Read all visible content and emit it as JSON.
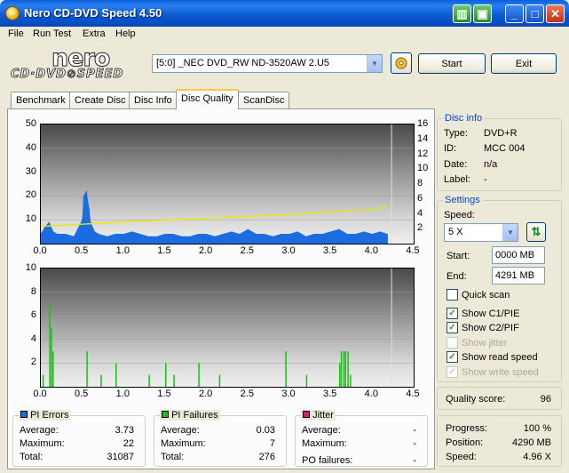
{
  "window": {
    "title": "Nero CD-DVD Speed 4.50"
  },
  "menu": [
    "File",
    "Run Test",
    "Extra",
    "Help"
  ],
  "logo": {
    "brand": "nero",
    "product": "CD·DVD⊘SPEED"
  },
  "drive": {
    "selected": "[5:0]  _NEC DVD_RW ND-3520AW 2.U5"
  },
  "buttons": {
    "start": "Start",
    "exit": "Exit"
  },
  "tabs": [
    "Benchmark",
    "Create Disc",
    "Disc Info",
    "Disc Quality",
    "ScanDisc"
  ],
  "active_tab": "Disc Quality",
  "disc_info": {
    "title": "Disc info",
    "type_label": "Type:",
    "type": "DVD+R",
    "id_label": "ID:",
    "id": "MCC 004",
    "date_label": "Date:",
    "date": "n/a",
    "label_label": "Label:",
    "label": "-"
  },
  "settings": {
    "title": "Settings",
    "speed_label": "Speed:",
    "speed": "5 X",
    "start_label": "Start:",
    "start": "0000 MB",
    "end_label": "End:",
    "end": "4291 MB",
    "quick_scan": "Quick scan",
    "show_c1pie": "Show C1/PIE",
    "show_c2pif": "Show C2/PIF",
    "show_jitter": "Show jitter",
    "show_read_speed": "Show read speed",
    "show_write_speed": "Show write speed"
  },
  "quality": {
    "label": "Quality score:",
    "value": "96"
  },
  "progress": {
    "progress_label": "Progress:",
    "progress": "100 %",
    "position_label": "Position:",
    "position": "4290 MB",
    "speed_label": "Speed:",
    "speed": "4.96 X"
  },
  "pi_errors": {
    "title": "PI Errors",
    "avg_label": "Average:",
    "avg": "3.73",
    "max_label": "Maximum:",
    "max": "22",
    "total_label": "Total:",
    "total": "31087",
    "color": "#1a6ce0"
  },
  "pi_failures": {
    "title": "PI Failures",
    "avg_label": "Average:",
    "avg": "0.03",
    "max_label": "Maximum:",
    "max": "7",
    "total_label": "Total:",
    "total": "276",
    "color": "#18c018"
  },
  "jitter": {
    "title": "Jitter",
    "avg_label": "Average:",
    "avg": "-",
    "max_label": "Maximum:",
    "max": "-",
    "po_label": "PO failures:",
    "po": "-",
    "color": "#e01870"
  },
  "chart_data": [
    {
      "type": "area",
      "title": "PI errors / read speed",
      "x_ticks": [
        "0.0",
        "0.5",
        "1.0",
        "1.5",
        "2.0",
        "2.5",
        "3.0",
        "3.5",
        "4.0",
        "4.5"
      ],
      "y_ticks_left": [
        "50",
        "40",
        "30",
        "20",
        "10"
      ],
      "y_ticks_right": [
        "16",
        "14",
        "12",
        "10",
        "8",
        "6",
        "4",
        "2"
      ],
      "xlim": [
        0,
        4.5
      ],
      "ylim": [
        0,
        50
      ],
      "y2lim": [
        0,
        16
      ],
      "series": [
        {
          "name": "PI Errors",
          "color": "#1a6ce0",
          "x": [
            0.0,
            0.05,
            0.1,
            0.15,
            0.2,
            0.3,
            0.4,
            0.5,
            0.52,
            0.55,
            0.58,
            0.6,
            0.65,
            0.7,
            0.8,
            0.9,
            1.0,
            1.1,
            1.2,
            1.3,
            1.4,
            1.5,
            1.6,
            1.7,
            1.8,
            1.9,
            2.0,
            2.1,
            2.2,
            2.3,
            2.4,
            2.5,
            2.6,
            2.7,
            2.8,
            2.9,
            3.0,
            3.1,
            3.2,
            3.3,
            3.4,
            3.5,
            3.6,
            3.7,
            3.8,
            3.9,
            4.0,
            4.1,
            4.18
          ],
          "y": [
            4,
            7,
            9,
            5,
            4,
            4,
            3,
            10,
            20,
            22,
            15,
            9,
            5,
            4,
            3,
            4,
            4,
            5,
            4,
            3,
            3,
            4,
            4,
            3,
            3,
            4,
            4,
            3,
            4,
            5,
            4,
            6,
            4,
            4,
            3,
            4,
            4,
            5,
            3,
            4,
            4,
            5,
            6,
            4,
            4,
            5,
            4,
            5,
            4
          ]
        },
        {
          "name": "Read Speed",
          "color": "#e8e800",
          "x": [
            0.0,
            1.0,
            2.0,
            3.0,
            4.0,
            4.18
          ],
          "y": [
            2.3,
            2.9,
            3.4,
            3.9,
            4.6,
            4.96
          ]
        }
      ]
    },
    {
      "type": "bar",
      "title": "PI failures",
      "x_ticks": [
        "0.0",
        "0.5",
        "1.0",
        "1.5",
        "2.0",
        "2.5",
        "3.0",
        "3.5",
        "4.0",
        "4.5"
      ],
      "y_ticks_left": [
        "10",
        "8",
        "6",
        "4",
        "2"
      ],
      "xlim": [
        0,
        4.5
      ],
      "ylim": [
        0,
        10
      ],
      "series": [
        {
          "name": "PI Failures",
          "color": "#18c018",
          "x": [
            0.02,
            0.1,
            0.12,
            0.14,
            0.55,
            0.72,
            0.9,
            1.3,
            1.5,
            1.6,
            1.9,
            2.15,
            2.95,
            3.2,
            3.6,
            3.62,
            3.65,
            3.67,
            3.7,
            3.73
          ],
          "y": [
            1,
            7,
            5,
            3,
            3,
            1,
            2,
            1,
            2,
            1,
            2,
            1,
            3,
            1,
            2,
            3,
            3,
            3,
            3,
            1
          ]
        }
      ]
    }
  ]
}
